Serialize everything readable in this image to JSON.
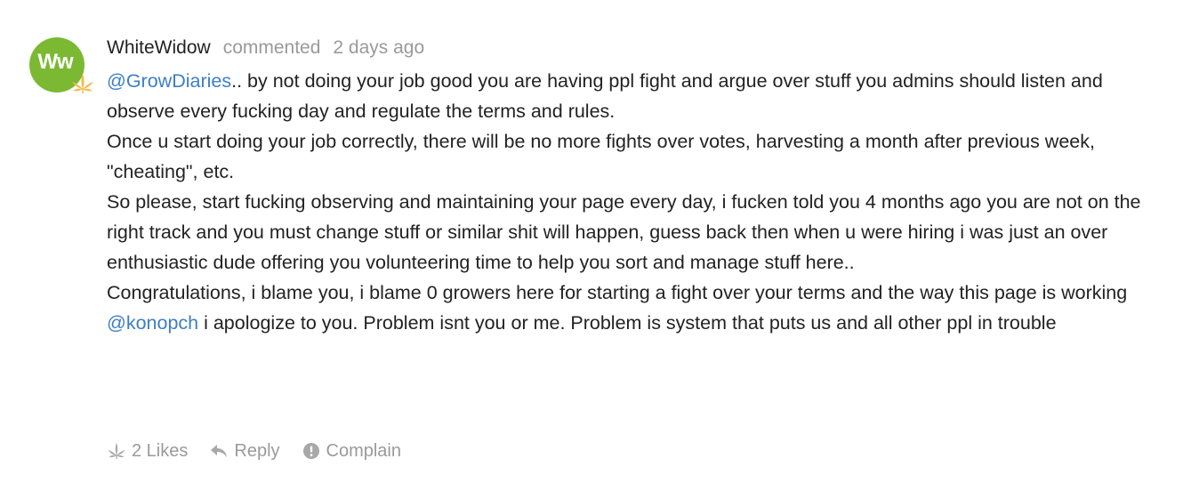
{
  "comment": {
    "avatar": {
      "initials": "Ww",
      "color": "#7cb933",
      "icon": "cannabis-leaf-icon"
    },
    "author": "WhiteWidow",
    "action": "commented",
    "time": "2 days ago",
    "paragraphs": [
      {
        "mention": "@GrowDiaries",
        "text": ".. by not doing your job good you are having ppl fight and argue over stuff you admins should listen and observe every fucking day and regulate the terms and rules."
      },
      {
        "mention": "",
        "text": "Once u start doing your job correctly, there will be no more fights over votes, harvesting a month after previous week, \"cheating\", etc."
      },
      {
        "mention": "",
        "text": "So please, start fucking observing and maintaining your page every day, i fucken told you 4 months ago you are not on the right track and you must change stuff or similar shit will happen, guess back then when u were hiring i was just an over enthusiastic dude offering you volunteering time to help you sort and manage stuff here.."
      },
      {
        "mention": "",
        "text": "Congratulations, i blame you, i blame 0 growers here for starting a fight over your terms and the way this page is working"
      },
      {
        "mention": "@konopch",
        "text": " i apologize to you. Problem isnt you or me. Problem is system that puts us and all other ppl in trouble"
      }
    ],
    "footer": {
      "likes_icon": "cannabis-leaf-icon",
      "likes_label": "2 Likes",
      "reply_icon": "reply-arrow-icon",
      "reply_label": "Reply",
      "complain_icon": "exclamation-circle-icon",
      "complain_label": "Complain"
    }
  },
  "colors": {
    "mention": "#3d7fc4",
    "muted": "#9a9a9a",
    "text": "#222222"
  }
}
